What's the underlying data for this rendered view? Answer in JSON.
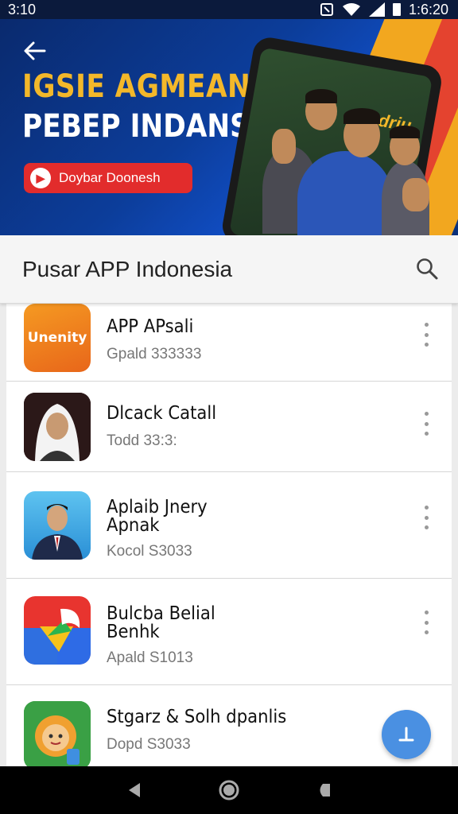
{
  "status_bar": {
    "time": "3:10",
    "clock": "1:6:20"
  },
  "banner": {
    "title_line1": "IGSIE AGMEAN",
    "title_line2": "PEBEP INDANSIA",
    "button_label": "Doybar Doonesh",
    "phone_text": "Adriu",
    "colors": {
      "title_accent": "#f3b82a",
      "button": "#e22c2c",
      "background": "#0c3d9a"
    }
  },
  "search_bar": {
    "title": "Pusar APP Indonesia"
  },
  "apps": [
    {
      "name_line1": "APP APsali",
      "name_line2": "",
      "subtitle": "Gpald 333333",
      "icon_text": "Unenity"
    },
    {
      "name_line1": "Dlcack Catall",
      "name_line2": "",
      "subtitle": "Todd 33:3:",
      "icon_text": ""
    },
    {
      "name_line1": "Aplaib Jnery",
      "name_line2": "Apnak",
      "subtitle": "Kocol S3033",
      "icon_text": ""
    },
    {
      "name_line1": "Bulcba Belial",
      "name_line2": "Benhk",
      "subtitle": "Apald S1013",
      "icon_text": ""
    },
    {
      "name_line1": "Stgarz & Solh dpanlis",
      "name_line2": "",
      "subtitle": "Dopd S3033",
      "icon_text": ""
    }
  ],
  "icons": {
    "back": "back-arrow-icon",
    "search": "search-icon",
    "more": "more-vertical-icon",
    "fab": "download-icon",
    "nav": [
      "back-triangle-icon",
      "home-circle-icon",
      "recents-icon"
    ]
  }
}
